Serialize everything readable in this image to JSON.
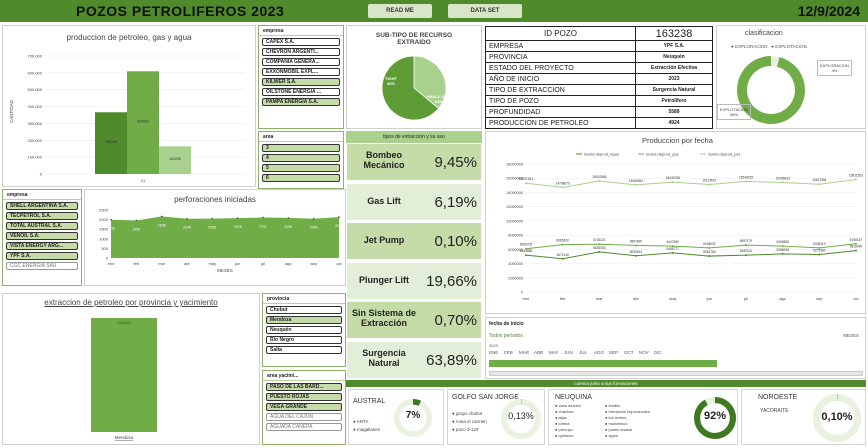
{
  "header": {
    "title": "POZOS PETROLIFEROS 2023",
    "read_me": "READ ME",
    "data_set": "DATA SET",
    "date": "12/9/2024"
  },
  "chart_prod": {
    "title": "produccion de petroleo, gas y agua",
    "ylabel": "CANTIDAD",
    "xlabel": "01"
  },
  "slicer_empresa": {
    "head": "empresa",
    "items": [
      "CAPEX S.A.",
      "CHEVRON ARGENTI...",
      "COMPAÑIA GENERA...",
      "EXXONMOBIL EXPL...",
      "KILWER S.A.",
      "OILSTONE ENERGIA ...",
      "PAMPA ENERGIA S.A."
    ]
  },
  "slicer_area": {
    "head": "area",
    "items": [
      "3",
      "4",
      "5",
      "6"
    ]
  },
  "slicer_empresa2": {
    "head": "empresa",
    "items": [
      "SHELL ARGENTINA S.A.",
      "TECPETROL S.A.",
      "TOTAL AUSTRAL S.A.",
      "VENOIL S.A.",
      "VISTA ENERGY ARG...",
      "YPF S.A.",
      "CGC ENERGIA SAU"
    ]
  },
  "chart_perf": {
    "title": "perforaciones iniciadas",
    "xlabel": "MESES"
  },
  "chart_extr": {
    "title": "extraccion de petroleo por provincia y yacimiento"
  },
  "slicer_provincia": {
    "head": "provincia",
    "items": [
      "Chubut",
      "Mendoza",
      "Neuquén",
      "Río Negro",
      "Salta"
    ]
  },
  "slicer_area2": {
    "head": "area yacimi...",
    "items": [
      "PASO DE LAS BARD...",
      "PUESTO ROJAS",
      "VEGA GRANDE",
      "AGUA DEL CAJON",
      "AGUADA CÁNEPA"
    ]
  },
  "subtipo": {
    "title": "SUB-TIPO DE RECURSO EXTRAIDO",
    "tight": "TIGHT",
    "tight_pct": "36%",
    "shale": "SHALE GAS",
    "shale_pct": "64%"
  },
  "well": {
    "id_label": "ID POZO",
    "id_value": "163238",
    "rows": [
      {
        "label": "EMPRESA",
        "value": "YPF S.A."
      },
      {
        "label": "PROVINCIA",
        "value": "Neuquén"
      },
      {
        "label": "ESTADO DEL PROYECTO",
        "value": "Extracción Efectiva"
      },
      {
        "label": "AÑO DE INICIO",
        "value": "2023"
      },
      {
        "label": "TIPO DE EXTRACCION",
        "value": "Surgencia Natural"
      },
      {
        "label": "TIPO DE POZO",
        "value": "Petrolífero"
      },
      {
        "label": "PROFUNDIDAD",
        "value": "5589"
      },
      {
        "label": "PRODUCCION DE PETROLEO",
        "value": "4924"
      }
    ]
  },
  "clasificacion": {
    "title": "clasificacion",
    "legend1": "EXPLORACION",
    "legend2": "EXPLOTACION",
    "explo_label": "EXPLORACION",
    "explo_pct": "4%",
    "explot_label": "EXPLOTACION",
    "explot_pct": "96%"
  },
  "extraccion": {
    "title": "tipos de extraccion y su uso",
    "rows": [
      {
        "label": "Bombeo Mecánico",
        "value": "9,45%"
      },
      {
        "label": "Gas Lift",
        "value": "6,19%"
      },
      {
        "label": "Jet Pump",
        "value": "0,10%"
      },
      {
        "label": "Plunger Lift",
        "value": "19,66%"
      },
      {
        "label": "Sin Sistema de Extracción",
        "value": "0,70%"
      },
      {
        "label": "Surgencia Natural",
        "value": "63,89%"
      }
    ]
  },
  "chart_fecha": {
    "title": "Produccion por fecha",
    "legend": [
      "Suma deprod_agua",
      "Suma deprod_gas",
      "Suma deprod_pet"
    ]
  },
  "timeline": {
    "title": "fecha de inicio",
    "all": "Todos periodos",
    "unit": "MESES",
    "year": "2023",
    "months": [
      "ENE",
      "FEB",
      "MAR",
      "ABR",
      "MAY",
      "JUN",
      "JUL",
      "AGO",
      "SEP",
      "OCT",
      "NOV",
      "DIC"
    ]
  },
  "basins": {
    "header": "cuenca junto a sus formaciones",
    "austral": {
      "name": "AUSTRAL",
      "pct": "7%",
      "items": [
        "ANTA",
        "magallanes"
      ]
    },
    "golfo": {
      "name": "GOLFO SAN JORGE",
      "pct": "0,13%",
      "items": [
        "grupo chubut",
        "mina el carmen",
        "pozo d-129"
      ]
    },
    "neuquina": {
      "name": "NEUQUINA",
      "pct": "92%",
      "items": [
        "vaca muerta",
        "chachao",
        "lajas",
        "lotena",
        "precuyo",
        "quintuco"
      ],
      "items2": [
        "tordillo",
        "formación improductiva",
        "los molles",
        "mulichinco",
        "punta rosada",
        "signo"
      ]
    },
    "noroeste": {
      "name": "NOROESTE",
      "pct": "0,10%",
      "items": [
        "YACORAITE"
      ]
    }
  },
  "chart_data": [
    {
      "type": "bar",
      "categories": [
        "01"
      ],
      "series": [
        {
          "name": "Suma deprod_agua",
          "values": [
            366198
          ]
        },
        {
          "name": "Suma deprod_gas",
          "values": [
            609560
          ]
        },
        {
          "name": "Suma deprod_pet",
          "values": [
            164200
          ]
        }
      ],
      "title": "produccion de petroleo, gas y agua",
      "ylabel": "CANTIDAD",
      "ylim": [
        0,
        700000
      ],
      "yticks": [
        "0",
        "100.000",
        "200.000",
        "300.000",
        "400.000",
        "500.000",
        "600.000",
        "700.000"
      ]
    },
    {
      "type": "area",
      "categories": [
        "ene",
        "feb",
        "mar",
        "abr",
        "may",
        "jun",
        "jul",
        "ago",
        "sep",
        "oct"
      ],
      "values": [
        1995,
        1956,
        2168,
        2045,
        2053,
        2078,
        2111,
        2090,
        2045,
        2132
      ],
      "title": "perforaciones iniciadas",
      "xlabel": "MESES",
      "ylim": [
        0,
        2500
      ],
      "yticks": [
        "0",
        "500",
        "1000",
        "1500",
        "2000",
        "2500"
      ]
    },
    {
      "type": "bar",
      "categories": [
        "Mendoza"
      ],
      "values": [
        138229
      ],
      "title": "extraccion de petroleo por provincia y yacimiento"
    },
    {
      "type": "pie",
      "categories": [
        "TIGHT",
        "SHALE GAS"
      ],
      "values": [
        36,
        64
      ],
      "title": "SUB-TIPO DE RECURSO EXTRAIDO"
    },
    {
      "type": "pie",
      "categories": [
        "EXPLORACION",
        "EXPLOTACION"
      ],
      "values": [
        4,
        96
      ],
      "title": "clasificacion"
    },
    {
      "type": "line",
      "categories": [
        "ene",
        "feb",
        "mar",
        "abr",
        "may",
        "jun",
        "jul",
        "ago",
        "sep",
        "oct"
      ],
      "series": [
        {
          "name": "Suma deprod_agua",
          "values": [
            5183888,
            4671416,
            5635053,
            5095614,
            5498777,
            5053768,
            5182101,
            5356938,
            5270582,
            5816094
          ]
        },
        {
          "name": "Suma deprod_gas",
          "values": [
            6083705,
            6665320,
            6718221,
            6557820,
            6447980,
            6198633,
            6597179,
            6459888,
            6208319,
            6780157
          ]
        },
        {
          "name": "Suma deprod_pet",
          "values": [
            15297451,
            14708679,
            15610868,
            15066951,
            15449788,
            15114672,
            15548155,
            15395633,
            15157594,
            15811553
          ]
        }
      ],
      "title": "Produccion por fecha",
      "ylim": [
        0,
        18000000
      ],
      "yticks": [
        "0",
        "2000000",
        "4000000",
        "6000000",
        "8000000",
        "10000000",
        "12000000",
        "14000000",
        "16000000",
        "18000000"
      ]
    },
    {
      "type": "pie",
      "categories": [
        "AUSTRAL"
      ],
      "values": [
        7
      ]
    },
    {
      "type": "pie",
      "categories": [
        "GOLFO SAN JORGE"
      ],
      "values": [
        0.13
      ]
    },
    {
      "type": "pie",
      "categories": [
        "NEUQUINA"
      ],
      "values": [
        92
      ]
    },
    {
      "type": "pie",
      "categories": [
        "NOROESTE"
      ],
      "values": [
        0.1
      ]
    }
  ],
  "colors": {
    "dark_green": "#4f8a2b",
    "mid_green": "#70ad47",
    "light_green": "#a9d18e",
    "pale_green": "#d8e6c8"
  }
}
